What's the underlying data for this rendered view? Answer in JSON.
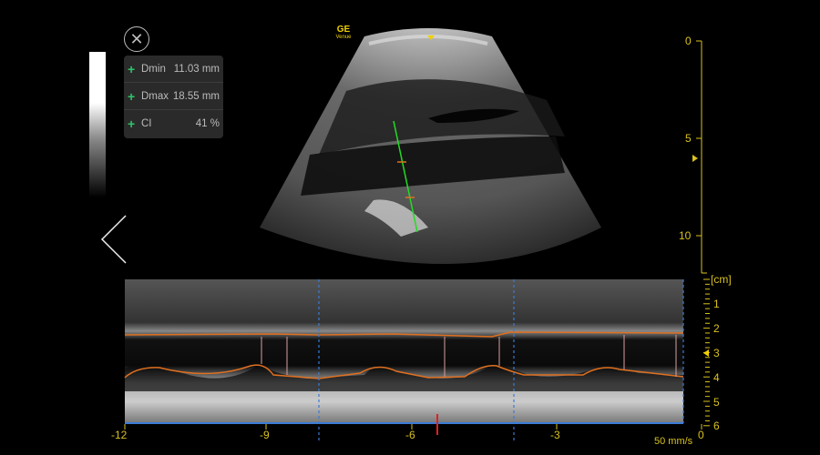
{
  "brand": {
    "name": "GE",
    "model": "Venue"
  },
  "measurements": [
    {
      "label": "Dmin",
      "value": "11.03 mm"
    },
    {
      "label": "Dmax",
      "value": "18.55 mm"
    },
    {
      "label": "CI",
      "value": "41 %"
    }
  ],
  "icons": {
    "close": "close-icon",
    "back": "chevron-left-icon",
    "add": "plus-icon"
  },
  "bmode_depth_scale": [
    "0",
    "5",
    "10"
  ],
  "mmode_depth_scale": {
    "unit": "[cm]",
    "labels": [
      "1",
      "2",
      "3",
      "4",
      "5",
      "6"
    ]
  },
  "time_axis": {
    "labels": [
      "-12",
      "-9",
      "-6",
      "-3",
      "0"
    ]
  },
  "sweep_speed": "50 mm/s",
  "colors": {
    "scale": "#d9c21f",
    "trace": "#e07020",
    "cursor": "#22dd22",
    "marker": "#3a7bd5",
    "accent_plus": "#2ec46a"
  }
}
